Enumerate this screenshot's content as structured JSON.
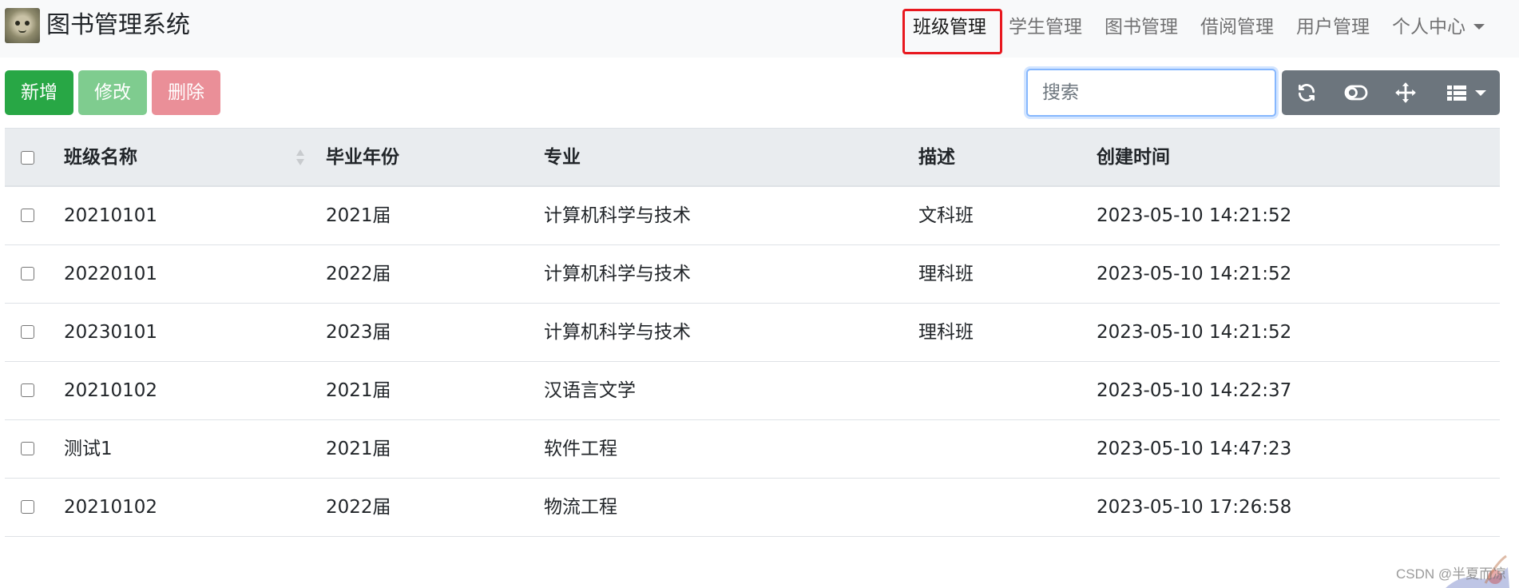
{
  "brand": {
    "title": "图书管理系统",
    "logo_icon": "cat-avatar-icon"
  },
  "nav": {
    "items": [
      {
        "label": "班级管理",
        "active": true
      },
      {
        "label": "学生管理"
      },
      {
        "label": "图书管理"
      },
      {
        "label": "借阅管理"
      },
      {
        "label": "用户管理"
      },
      {
        "label": "个人中心",
        "dropdown": true
      }
    ],
    "highlight_color": "#e8181f"
  },
  "toolbar": {
    "add_label": "新增",
    "edit_label": "修改",
    "delete_label": "删除",
    "search_placeholder": "搜索",
    "search_value": "",
    "icons": [
      "refresh-icon",
      "toggle-view-icon",
      "move-icon",
      "columns-icon"
    ]
  },
  "colors": {
    "add": "#28a745",
    "edit": "#7fcc8f",
    "delete": "#ea8f98",
    "tools": "#6c757d",
    "header_bg": "#e9ecef"
  },
  "table": {
    "columns": [
      "班级名称",
      "毕业年份",
      "专业",
      "描述",
      "创建时间"
    ],
    "rows": [
      [
        "20210101",
        "2021届",
        "计算机科学与技术",
        "文科班",
        "2023-05-10 14:21:52"
      ],
      [
        "20220101",
        "2022届",
        "计算机科学与技术",
        "理科班",
        "2023-05-10 14:21:52"
      ],
      [
        "20230101",
        "2023届",
        "计算机科学与技术",
        "理科班",
        "2023-05-10 14:21:52"
      ],
      [
        "20210102",
        "2021届",
        "汉语言文学",
        "",
        "2023-05-10 14:22:37"
      ],
      [
        "测试1",
        "2021届",
        "软件工程",
        "",
        "2023-05-10 14:47:23"
      ],
      [
        "20210102",
        "2022届",
        "物流工程",
        "",
        "2023-05-10 17:26:58"
      ]
    ]
  },
  "watermark": "CSDN @半夏而凉"
}
